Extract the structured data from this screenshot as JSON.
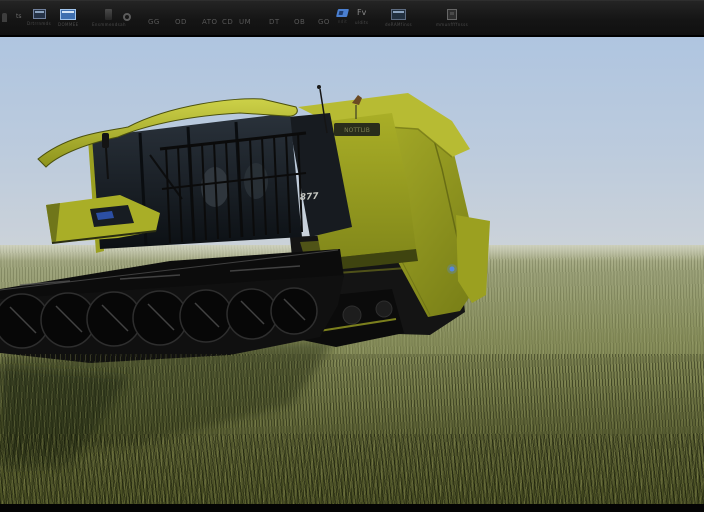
{
  "toolbar": {
    "buttons": [
      {
        "label": ""
      },
      {
        "glyph": "ts",
        "label": ""
      },
      {
        "label": "Drtrrnmds"
      },
      {
        "label": "DOMMEE"
      },
      {
        "label": "Ensmmendsah"
      },
      {
        "label": ""
      },
      {
        "label": "ndit"
      },
      {
        "glyph": "Fv",
        "label": "uldits"
      },
      {
        "label": "deRAMfinss"
      },
      {
        "label": "mmunffffnsss"
      }
    ],
    "text_buttons": [
      "GG",
      "OD",
      "ATO",
      "CD",
      "UM",
      "DT",
      "OB",
      "GO"
    ]
  },
  "viewport": {
    "vehicle_badge": "877",
    "brand_plate": "NOTTLIB"
  },
  "colors": {
    "sky_top": "#afc5e0",
    "sky_horizon": "#cbd2d9",
    "field_far": "#b5b894",
    "field_near": "#5d632f",
    "machine_body": "#a9ae27",
    "machine_dark": "#0e0e0e",
    "toolbar_bg": "#171717",
    "accent_blue": "#3e6fb0"
  }
}
